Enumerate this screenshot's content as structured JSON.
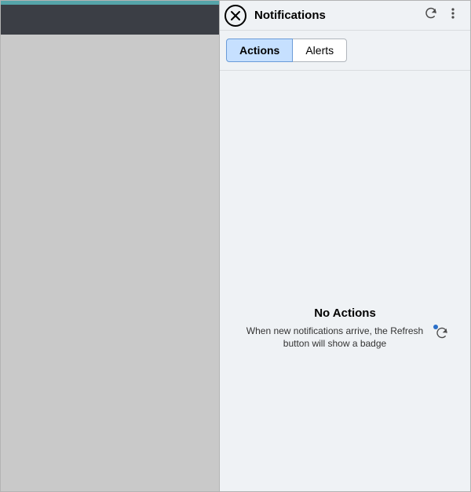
{
  "panel": {
    "title": "Notifications",
    "tabs": [
      {
        "label": "Actions",
        "active": true
      },
      {
        "label": "Alerts",
        "active": false
      }
    ],
    "emptyState": {
      "title": "No Actions",
      "description": "When new notifications arrive, the Refresh button will show a badge"
    }
  }
}
